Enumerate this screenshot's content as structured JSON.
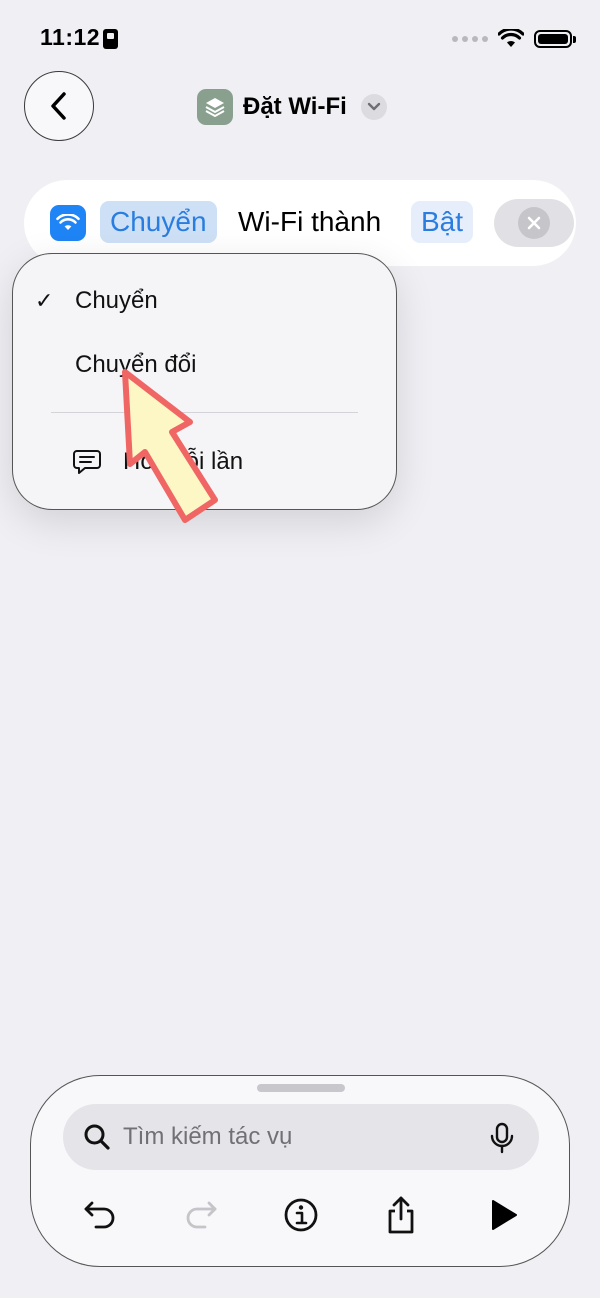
{
  "status_bar": {
    "time": "11:12"
  },
  "header": {
    "title": "Đặt Wi-Fi"
  },
  "action": {
    "mode_token": "Chuyển",
    "text": "Wi-Fi thành",
    "value_token": "Bật"
  },
  "menu": {
    "items": [
      {
        "label": "Chuyển",
        "checked": true
      },
      {
        "label": "Chuyển đổi",
        "checked": false
      },
      {
        "label": "Hỏi mỗi lần",
        "checked": false
      }
    ],
    "check_glyph": "✓"
  },
  "search": {
    "placeholder": "Tìm kiếm tác vụ"
  },
  "colors": {
    "accent": "#2a7de0",
    "wifi_tile": "#1f84f5",
    "app_icon": "#8aa08f",
    "arrow_fill": "#fdf7c6",
    "arrow_stroke": "#f06664"
  },
  "icons": {
    "back": "chevron-left-icon",
    "wifi": "wifi-icon",
    "remove": "close-icon",
    "ask": "message-icon",
    "search": "search-icon",
    "mic": "microphone-icon",
    "undo": "undo-icon",
    "redo": "redo-icon",
    "info": "info-icon",
    "share": "share-icon",
    "run": "play-icon"
  }
}
